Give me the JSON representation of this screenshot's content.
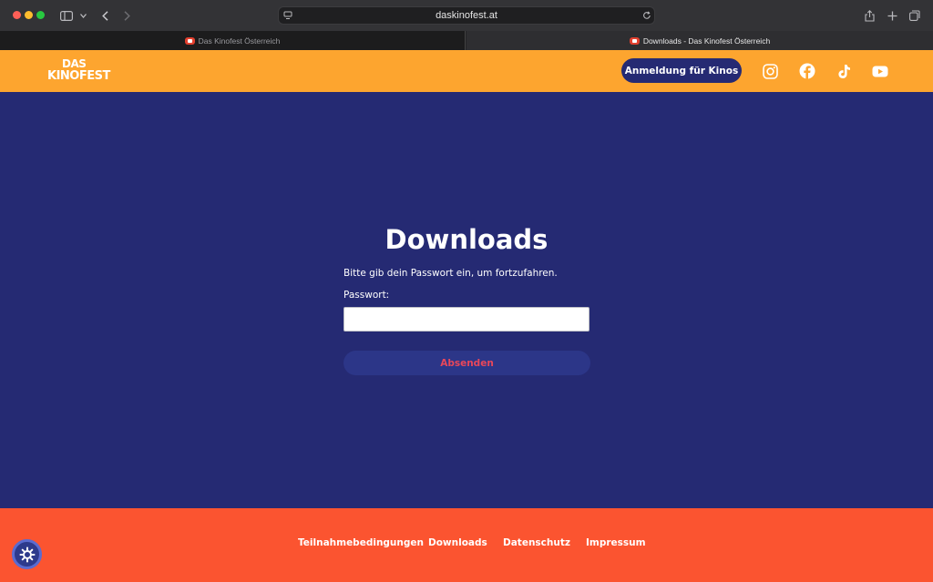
{
  "browser": {
    "url": "daskinofest.at",
    "tabs": [
      {
        "label": "Das Kinofest Österreich",
        "active": false
      },
      {
        "label": "Downloads - Das Kinofest Österreich",
        "active": true
      }
    ],
    "icons": [
      "sidebar-icon",
      "chevron-down-icon",
      "back-icon",
      "forward-icon",
      "site-settings-icon",
      "reload-icon",
      "share-icon",
      "new-tab-icon",
      "tab-overview-icon"
    ]
  },
  "header": {
    "logo_line1": "DAS",
    "logo_line2": "KINOFEST",
    "cta_label": "Anmeldung für Kinos",
    "social": [
      "instagram-icon",
      "facebook-icon",
      "tiktok-icon",
      "youtube-icon"
    ],
    "background": "#fda52f"
  },
  "main": {
    "title": "Downloads",
    "description": "Bitte gib dein Passwort ein, um fortzufahren.",
    "password_label": "Passwort:",
    "password_value": "",
    "submit_label": "Absenden",
    "background": "#252a73"
  },
  "footer": {
    "links": [
      "Teilnahmebedingungen",
      "Downloads",
      "Datenschutz",
      "Impressum"
    ],
    "background": "#fb5430",
    "badge_icon": "privacy-settings-icon"
  }
}
